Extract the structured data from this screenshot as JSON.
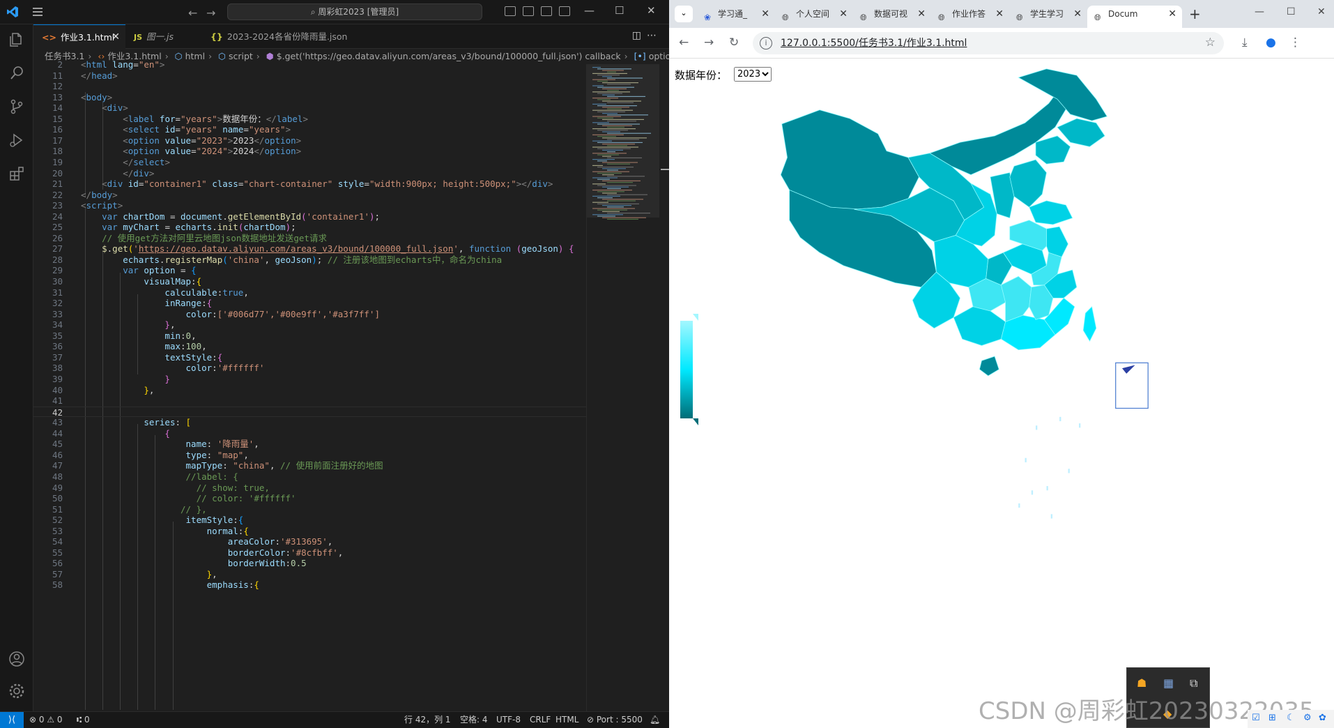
{
  "vscode": {
    "command_center": "周彩虹2023 [管理员]",
    "tabs": [
      {
        "icon": "<>",
        "label": "作业3.1.html",
        "active": true
      },
      {
        "icon": "JS",
        "label": "图一.js",
        "active": false
      },
      {
        "icon": "{}",
        "label": "2023-2024各省份降雨量.json",
        "active": false
      }
    ],
    "breadcrumb": [
      "任务书3.1",
      "作业3.1.html",
      "html",
      "script",
      "$.get('https://geo.datav.aliyun.com/areas_v3/bound/100000_full.json') callback",
      "option"
    ],
    "code": {
      "line_numbers": [
        "2",
        "11",
        "12",
        "13",
        "14",
        "15",
        "16",
        "17",
        "18",
        "19",
        "20",
        "21",
        "22",
        "23",
        "24",
        "25",
        "26",
        "27",
        "28",
        "29",
        "30",
        "31",
        "32",
        "33",
        "34",
        "35",
        "36",
        "37",
        "38",
        "39",
        "40",
        "41",
        "42",
        "43",
        "44",
        "45",
        "46",
        "47",
        "48",
        "49",
        "50",
        "51",
        "52",
        "53",
        "54",
        "55",
        "56",
        "57",
        "58"
      ],
      "current_line": "42",
      "html_lang": "en",
      "label_for": "years",
      "label_text": "数据年份：",
      "select_id": "years",
      "select_name": "years",
      "opt1_value": "2023",
      "opt1_text": "2023",
      "opt2_value": "2024",
      "opt2_text": "2024",
      "container_id": "container1",
      "container_class": "chart-container",
      "container_style": "width:900px; height:500px;",
      "dom_id": "'container1'",
      "comment1": "// 使用get方法对阿里云地图json数据地址发送get请求",
      "geo_url": "https://geo.datav.aliyun.com/areas_v3/bound/100000_full.json",
      "map_name": "'china'",
      "comment2": "// 注册该地图到echarts中，命名为china",
      "colors": "['#006d77','#00e9ff','#a3f7ff']",
      "min": "0",
      "max": "100",
      "text_color": "'#ffffff'",
      "series_name": "'降雨量'",
      "series_type": "\"map\"",
      "series_maptype": "\"china\"",
      "comment3": "// 使用前面注册好的地图",
      "label_comment": "//label: {",
      "show_comment": "// show: true,",
      "color_comment": "// color: '#ffffff'",
      "close_comment": "// },",
      "area_color": "'#313695'",
      "border_color": "'#8cfbff'",
      "border_width": "0.5"
    },
    "status": {
      "errors": "⊗ 0 ⚠ 0",
      "ports": "⑆ 0",
      "position": "行 42，列 1",
      "spaces": "空格: 4",
      "encoding": "UTF-8",
      "eol": "CRLF",
      "language": "HTML",
      "live_server": "Port : 5500"
    }
  },
  "browser": {
    "tabs": [
      "学习通_",
      "个人空间",
      "数据可视",
      "作业作答",
      "学生学习",
      "Docum"
    ],
    "url": "127.0.0.1:5500/任务书3.1/作业3.1.html",
    "page": {
      "label": "数据年份：",
      "selected_year": "2023",
      "year_options": [
        "2023",
        "2024"
      ]
    }
  },
  "chart_data": {
    "type": "map",
    "map": "china",
    "visual_map": {
      "min": 0,
      "max": 100,
      "colors": [
        "#006d77",
        "#00e9ff",
        "#a3f7ff"
      ],
      "calculable": true
    },
    "colors": {
      "border": "#8cfbff",
      "low": "#006d77",
      "mid": "#00e9ff",
      "high": "#a3f7ff"
    }
  },
  "overlay": {
    "watermark": "CSDN @周彩虹20230322035"
  }
}
